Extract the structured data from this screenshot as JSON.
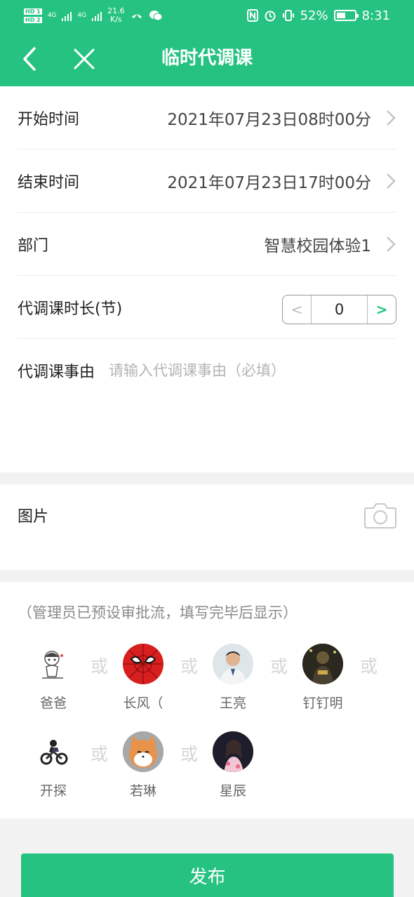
{
  "status_bar": {
    "hd1": "HD 1",
    "hd2": "HD 2",
    "net1": "4G",
    "net2": "4G",
    "speed_value": "21.6",
    "speed_unit": "K/s",
    "battery_percent": "52%",
    "battery_level": 0.52,
    "time": "8:31"
  },
  "header": {
    "title": "临时代调课",
    "back_icon": "chevron-left-icon",
    "close_icon": "close-icon"
  },
  "form": {
    "start": {
      "label": "开始时间",
      "value": "2021年07月23日08时00分"
    },
    "end": {
      "label": "结束时间",
      "value": "2021年07月23日17时00分"
    },
    "department": {
      "label": "部门",
      "value": "智慧校园体验1"
    },
    "duration": {
      "label": "代调课时长(节)",
      "value": "0",
      "minus": "<",
      "plus": ">"
    },
    "reason": {
      "label": "代调课事由",
      "placeholder": "请输入代调课事由（必填）",
      "value": ""
    }
  },
  "picture": {
    "label": "图片",
    "icon": "camera-icon"
  },
  "approval": {
    "hint": "（管理员已预设审批流，填写完毕后显示）",
    "or_text": "或",
    "people": [
      {
        "name": "爸爸"
      },
      {
        "name": "长风（"
      },
      {
        "name": "王亮"
      },
      {
        "name": "钉钉明"
      },
      {
        "name": "开探"
      },
      {
        "name": "若琳"
      },
      {
        "name": "星辰"
      }
    ]
  },
  "actions": {
    "publish": "发布"
  },
  "colors": {
    "brand": "#26c281",
    "placeholder": "#b4b4b4"
  }
}
